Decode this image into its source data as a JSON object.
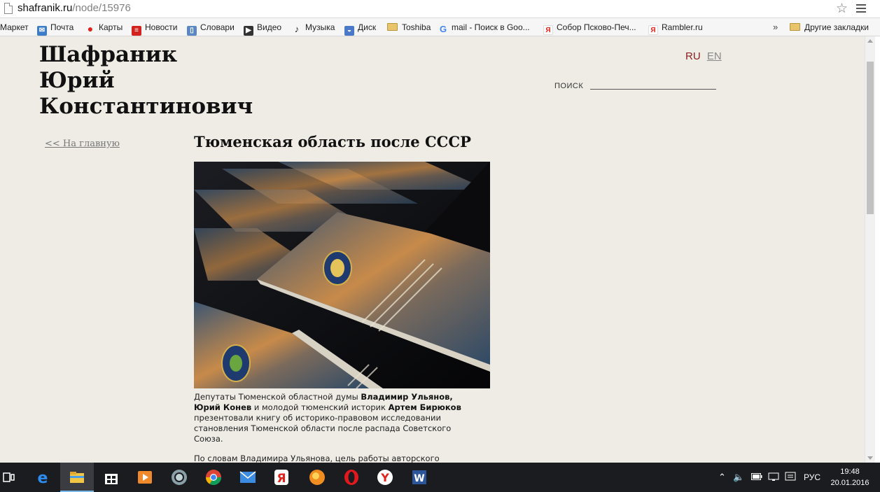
{
  "address_bar": {
    "host": "shafranik.ru",
    "path": "/node/15976"
  },
  "bookmarks": {
    "items": [
      {
        "label": "Маркет",
        "icon": "market-icon"
      },
      {
        "label": "Почта",
        "icon": "mail-icon"
      },
      {
        "label": "Карты",
        "icon": "map-pin-icon"
      },
      {
        "label": "Новости",
        "icon": "news-icon"
      },
      {
        "label": "Словари",
        "icon": "dictionary-icon"
      },
      {
        "label": "Видео",
        "icon": "video-icon"
      },
      {
        "label": "Музыка",
        "icon": "music-icon"
      },
      {
        "label": "Диск",
        "icon": "disk-icon"
      },
      {
        "label": "Toshiba",
        "icon": "folder-icon"
      },
      {
        "label": "mail - Поиск в Goo...",
        "icon": "google-icon"
      },
      {
        "label": "Собор Псково-Печ...",
        "icon": "yandex-icon"
      },
      {
        "label": "Rambler.ru",
        "icon": "yandex-icon"
      }
    ],
    "more": "»",
    "other_bookmarks": "Другие закладки"
  },
  "site": {
    "title_line1": "Шафраник",
    "title_line2": "Юрий",
    "title_line3": "Константинович",
    "lang_ru": "RU",
    "lang_en": "EN",
    "search_label": "ПОИСК",
    "search_value": ""
  },
  "nav": {
    "home_link": "<< На главную"
  },
  "article": {
    "title": "Тюменская область после СССР",
    "photo_icon": "book-stack-photo",
    "p1_lead": "Депутаты Тюменской областной думы ",
    "p1_bold1": "Владимир Ульянов, Юрий Конев",
    "p1_mid": " и молодой тюменский историк ",
    "p1_bold2": "Артем Бирюков",
    "p1_tail": " презентовали книгу об историко-правовом исследовании становления Тюменской области после распада Советского Союза.",
    "p2": "По словам Владимира Ульянова, цель работы авторского коллектива в том, чтобы на основе документального материала, нормативно-правовых актов, архивных материалов, публикаций в"
  },
  "taskbar": {
    "lang": "РУС",
    "time": "19:48",
    "date": "20.01.2016"
  },
  "colors": {
    "page_bg": "#efece6",
    "lang_active": "#8c1d1d",
    "taskbar_bg": "#1b1c20"
  }
}
